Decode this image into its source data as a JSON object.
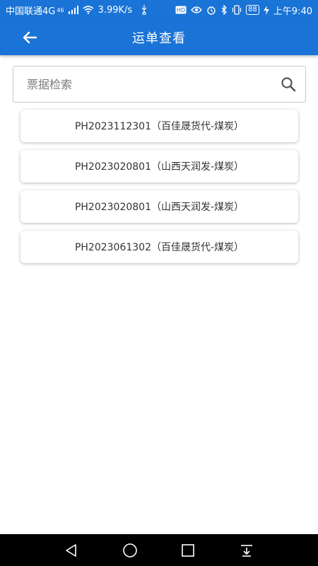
{
  "status_bar": {
    "carrier": "中国联通4G",
    "network_badge": "46",
    "speed": "3.99K/s",
    "battery": "88",
    "time": "上午9:40"
  },
  "app_bar": {
    "title": "运单查看"
  },
  "search": {
    "placeholder": "票据检索"
  },
  "waybills": [
    {
      "label": "PH2023112301（百佳晟货代-煤炭）"
    },
    {
      "label": "PH2023020801（山西天润发-煤炭）"
    },
    {
      "label": "PH2023020801（山西天润发-煤炭）"
    },
    {
      "label": "PH2023061302（百佳晟货代-煤炭）"
    }
  ],
  "icons": {
    "back": "arrow-left-icon",
    "search": "search-icon",
    "nav_back": "triangle-back-icon",
    "nav_home": "circle-home-icon",
    "nav_recent": "square-recent-icon",
    "nav_dropdown": "notification-pull-icon"
  },
  "colors": {
    "primary": "#1a73d6",
    "nav": "#000000"
  }
}
